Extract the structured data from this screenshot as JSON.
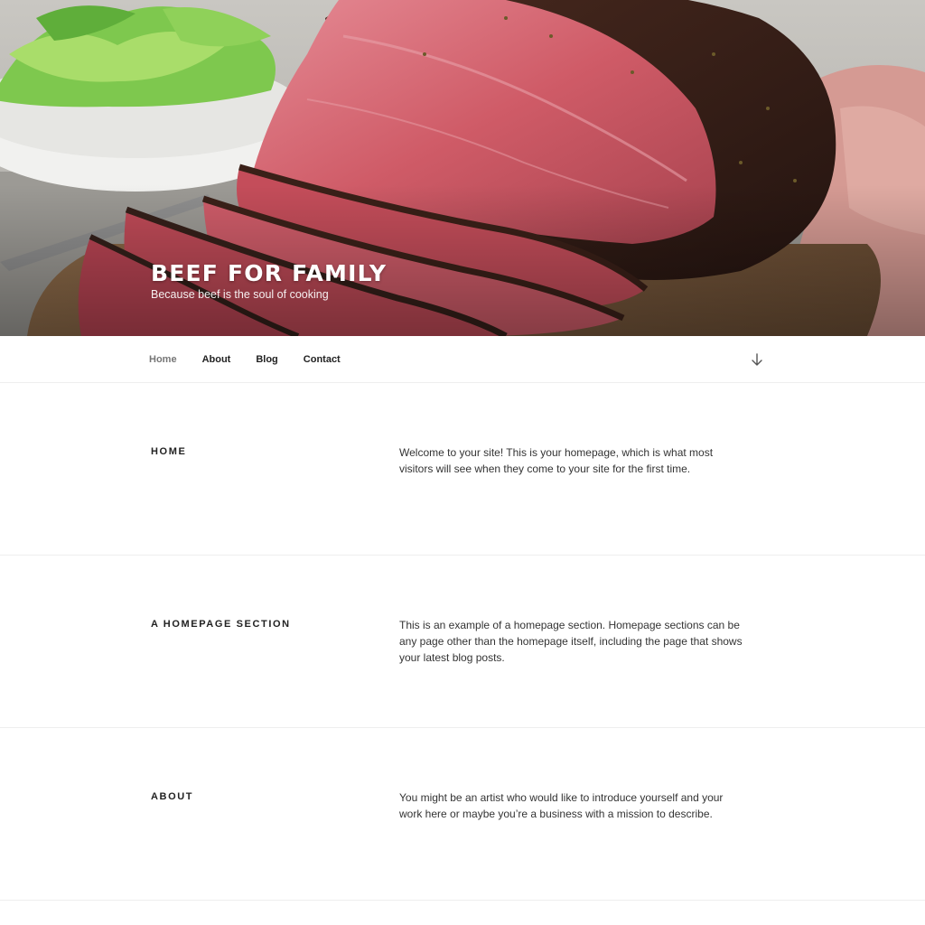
{
  "site": {
    "title": "BEEF FOR FAMILY",
    "tagline": "Because beef is the soul of cooking"
  },
  "nav": {
    "items": [
      {
        "label": "Home",
        "current": true
      },
      {
        "label": "About",
        "current": false
      },
      {
        "label": "Blog",
        "current": false
      },
      {
        "label": "Contact",
        "current": false
      }
    ],
    "scroll_icon": "arrow-down-icon"
  },
  "sections": [
    {
      "title": "HOME",
      "body": "Welcome to your site! This is your homepage, which is what most visitors will see when they come to your site for the first time."
    },
    {
      "title": "A HOMEPAGE SECTION",
      "body": "This is an example of a homepage section. Homepage sections can be any page other than the homepage itself, including the page that shows your latest blog posts."
    },
    {
      "title": "ABOUT",
      "body": "You might be an artist who would like to introduce yourself and your work here or maybe you’re a business with a mission to describe."
    }
  ],
  "colors": {
    "text": "#222222",
    "nav_current": "#767676",
    "divider": "#eeeeee",
    "meat": "#c9545e",
    "crust": "#3a2018"
  }
}
